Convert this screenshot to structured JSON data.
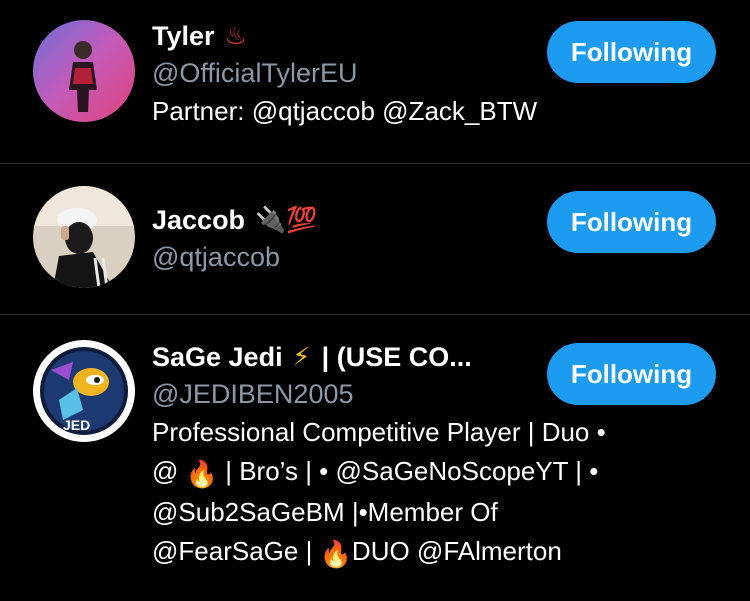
{
  "accent_color": "#1d9bf0",
  "users": [
    {
      "name": "Tyler",
      "name_emoji": "♨",
      "handle": "@OfficialTylerEU",
      "bio_lines": [
        "Partner: @qtjaccob @Zack_BTW"
      ],
      "button_label": "Following"
    },
    {
      "name": "Jaccob",
      "name_emoji": "🔌💯",
      "handle": "@qtjaccob",
      "button_label": "Following"
    },
    {
      "name": "SaGe Jedi",
      "name_emoji": "⚡",
      "name_suffix": " | (USE CO...",
      "handle": "@JEDIBEN2005",
      "bio_line1": "Professional Competitive Player | Duo •",
      "bio_line2_a": "@ ",
      "bio_line2_b": " | Bro’s | • @SaGeNoScopeYT | •",
      "bio_line3": "@Sub2SaGeBM |•Member Of",
      "bio_line4_a": "@FearSaGe | ",
      "bio_line4_b": "DUO @FAlmerton",
      "bio_emoji": "🔥",
      "button_label": "Following"
    }
  ]
}
